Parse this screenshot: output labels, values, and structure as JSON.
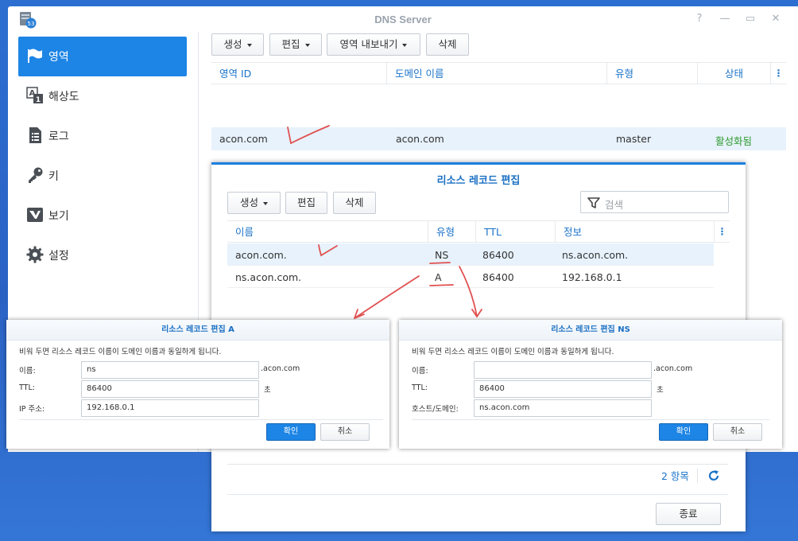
{
  "window": {
    "title": "DNS Server"
  },
  "sidebar": {
    "items": [
      {
        "label": "영역",
        "icon": "flag-icon",
        "active": true
      },
      {
        "label": "해상도",
        "icon": "resolution-icon",
        "active": false
      },
      {
        "label": "로그",
        "icon": "log-icon",
        "active": false
      },
      {
        "label": "키",
        "icon": "key-icon",
        "active": false
      },
      {
        "label": "보기",
        "icon": "view-icon",
        "active": false
      },
      {
        "label": "설정",
        "icon": "gear-icon",
        "active": false
      }
    ]
  },
  "toolbar": {
    "create": "생성",
    "edit": "편집",
    "export": "영역 내보내기",
    "delete": "삭제"
  },
  "zone_table": {
    "headers": [
      "영역 ID",
      "도메인 이름",
      "유형",
      "상태"
    ],
    "rows": [
      {
        "zone_id": "acon.com",
        "domain": "acon.com",
        "type": "master",
        "status": "활성화됨"
      }
    ]
  },
  "rr_dialog": {
    "title": "리소스 레코드 편집",
    "create": "생성",
    "edit": "편집",
    "delete": "삭제",
    "search_placeholder": "검색",
    "headers": [
      "이름",
      "유형",
      "TTL",
      "정보"
    ],
    "rows": [
      {
        "name": "acon.com.",
        "type": "NS",
        "ttl": "86400",
        "info": "ns.acon.com."
      },
      {
        "name": "ns.acon.com.",
        "type": "A",
        "ttl": "86400",
        "info": "192.168.0.1"
      }
    ],
    "count": "2 항목",
    "close": "종료"
  },
  "dialog_a": {
    "title": "리소스 레코드 편집 A",
    "hint": "비워 두면 리소스 레코드 이름이 도메인 이름과 동일하게 됩니다.",
    "name_label": "이름:",
    "name_value": "ns",
    "suffix": ".acon.com",
    "ttl_label": "TTL:",
    "ttl_value": "86400",
    "ttl_unit": "초",
    "ip_label": "IP 주소:",
    "ip_value": "192.168.0.1",
    "ok": "확인",
    "cancel": "취소"
  },
  "dialog_ns": {
    "title": "리소스 레코드 편집 NS",
    "hint": "비워 두면 리소스 레코드 이름이 도메인 이름과 동일하게 됩니다.",
    "name_label": "이름:",
    "name_value": "",
    "suffix": ".acon.com",
    "ttl_label": "TTL:",
    "ttl_value": "86400",
    "ttl_unit": "초",
    "host_label": "호스트/도메인:",
    "host_value": "ns.acon.com",
    "ok": "확인",
    "cancel": "취소"
  },
  "colors": {
    "accent": "#1d85e5",
    "status_active": "#2e9a2e",
    "annotation": "#e05050"
  }
}
